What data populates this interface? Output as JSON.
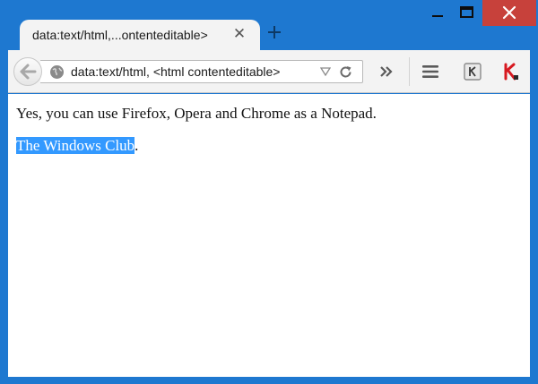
{
  "tab": {
    "title": "data:text/html,...ontenteditable>"
  },
  "toolbar": {
    "url": "data:text/html, <html contenteditable>"
  },
  "document": {
    "line1": "Yes, you can use Firefox, Opera and Chrome as a Notepad.",
    "selected_text": "The Windows Club",
    "after_selection": "."
  },
  "colors": {
    "titlebar": "#1e78d0",
    "close_button": "#c7413b",
    "selection": "#3399ff"
  },
  "icons": [
    "back-arrow-icon",
    "globe-icon",
    "dropdown-icon",
    "reload-icon",
    "overflow-icon",
    "menu-icon",
    "kaspersky-k-icon",
    "kaspersky-red-icon"
  ]
}
